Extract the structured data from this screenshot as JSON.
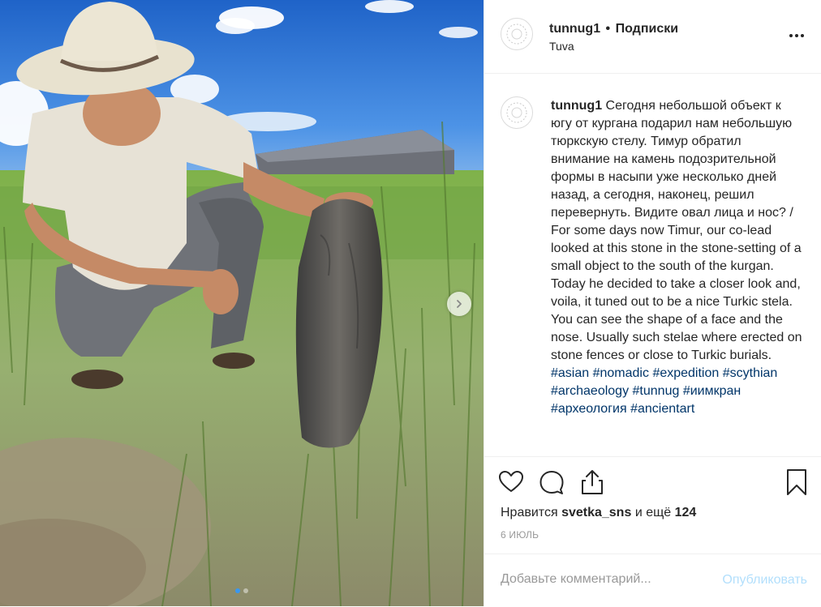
{
  "post": {
    "username": "tunnug1",
    "follow_label": "Подписки",
    "separator": "•",
    "location": "Tuva"
  },
  "caption": {
    "username": "tunnug1",
    "text": "Сегодня небольшой объект к югу от кургана подарил нам небольшую тюркскую стелу. Тимур обратил внимание на камень подозрительной формы в насыпи уже несколько дней назад, а сегодня, наконец, решил перевернуть. Видите овал лица и нос? / For some days now Timur, our co-lead looked at this stone in the stone-setting of a small object to the south of the kurgan. Today he decided to take a closer look and, voila, it tuned out to be a nice Turkic stela. You can see the shape of a face and the nose. Usually such stelae where erected on stone fences or close to Turkic burials.",
    "hashtags": [
      "#asian",
      "#nomadic",
      "#expedition",
      "#scythian",
      "#archaeology",
      "#tunnug",
      "#иимкран",
      "#археология",
      "#ancientart"
    ]
  },
  "likes": {
    "prefix": "Нравится",
    "user": "svetka_sns",
    "middle": "и ещё",
    "count": "124"
  },
  "date": "6 ИЮЛЬ",
  "comment": {
    "placeholder": "Добавьте комментарий...",
    "publish_label": "Опубликовать"
  },
  "icons": {
    "like": "heart-icon",
    "comment": "comment-bubble-icon",
    "share": "share-icon",
    "save": "bookmark-icon",
    "more": "more-options-icon",
    "next": "chevron-right-icon"
  },
  "carousel": {
    "slides": 2,
    "active": 1
  },
  "colors": {
    "hashtag": "#003569",
    "publish_disabled": "#b2dffc",
    "carousel_active": "#3897f0",
    "muted": "#999999"
  }
}
